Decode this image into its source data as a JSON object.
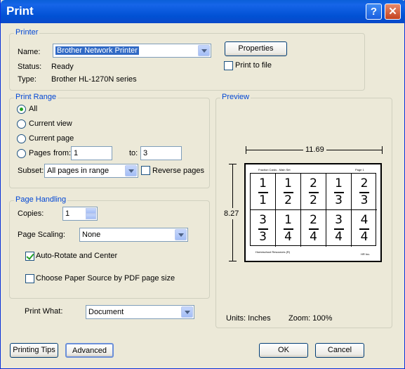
{
  "window": {
    "title": "Print",
    "help_glyph": "?",
    "close_glyph": "✕"
  },
  "printer": {
    "group_label": "Printer",
    "name_label": "Name:",
    "name_value": "Brother Network Printer",
    "status_label": "Status:",
    "status_value": "Ready",
    "type_label": "Type:",
    "type_value": "Brother HL-1270N series",
    "properties_button": "Properties",
    "print_to_file_label": "Print to file",
    "print_to_file_checked": false
  },
  "print_range": {
    "group_label": "Print Range",
    "options": [
      "All",
      "Current view",
      "Current page",
      "Pages"
    ],
    "selected": "All",
    "from_label": "from:",
    "from_value": "1",
    "to_label": "to:",
    "to_value": "3",
    "subset_label": "Subset:",
    "subset_value": "All pages in range",
    "reverse_label": "Reverse pages",
    "reverse_checked": false
  },
  "page_handling": {
    "group_label": "Page Handling",
    "copies_label": "Copies:",
    "copies_value": "1",
    "scaling_label": "Page Scaling:",
    "scaling_value": "None",
    "auto_rotate_label": "Auto-Rotate and Center",
    "auto_rotate_checked": true,
    "paper_source_label": "Choose Paper Source by PDF page size",
    "paper_source_checked": false
  },
  "print_what": {
    "label": "Print What:",
    "value": "Document"
  },
  "preview": {
    "group_label": "Preview",
    "width": "11.69",
    "height": "8.27",
    "units": "Units: Inches",
    "zoom": "Zoom: 100%",
    "sheet": {
      "header_left": "Fraction Cards - Main Set",
      "header_right": "Page 1",
      "footer_left": "Homeschool Resources (R)",
      "footer_right": "HR Inc.",
      "cards": [
        {
          "n": "1",
          "d": "1"
        },
        {
          "n": "1",
          "d": "2"
        },
        {
          "n": "2",
          "d": "2"
        },
        {
          "n": "1",
          "d": "3"
        },
        {
          "n": "2",
          "d": "3"
        },
        {
          "n": "3",
          "d": "3"
        },
        {
          "n": "1",
          "d": "4"
        },
        {
          "n": "2",
          "d": "4"
        },
        {
          "n": "3",
          "d": "4"
        },
        {
          "n": "4",
          "d": "4"
        }
      ]
    }
  },
  "buttons": {
    "printing_tips": "Printing Tips",
    "advanced": "Advanced",
    "ok": "OK",
    "cancel": "Cancel"
  }
}
